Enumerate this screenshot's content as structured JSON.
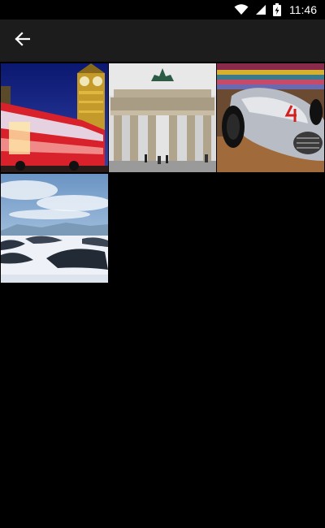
{
  "status_bar": {
    "time": "11:46",
    "icons": [
      "wifi-icon",
      "cell-signal-icon",
      "battery-charging-icon"
    ]
  },
  "app_bar": {
    "back_icon": "arrow-back-icon"
  },
  "gallery": {
    "images": [
      {
        "subject": "london-bus-big-ben"
      },
      {
        "subject": "brandenburg-gate"
      },
      {
        "subject": "silver-race-car"
      },
      {
        "subject": "snowy-landscape"
      }
    ]
  },
  "colors": {
    "app_bar_bg": "#1c1c1c",
    "screen_bg": "#000000",
    "icon": "#ffffff"
  }
}
